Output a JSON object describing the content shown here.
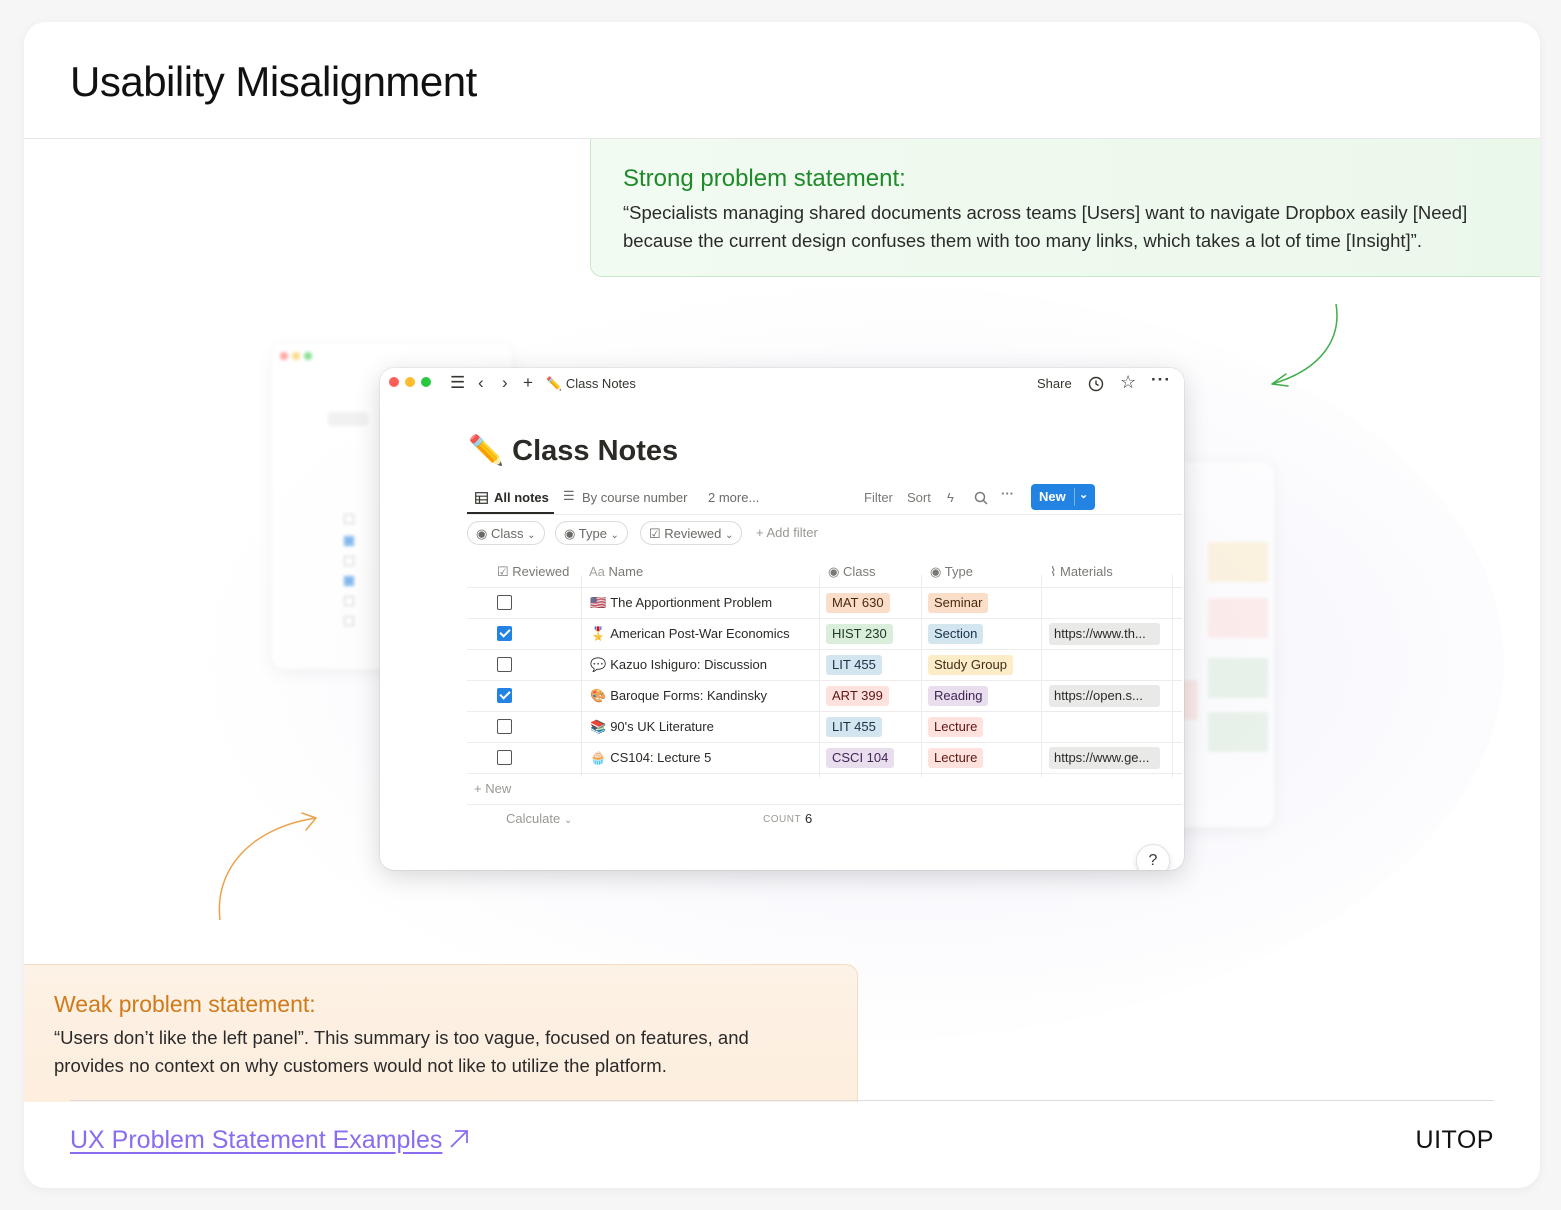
{
  "page": {
    "title": "Usability Misalignment"
  },
  "strong": {
    "heading": "Strong problem statement:",
    "text": "“Specialists managing shared documents across teams [Users] want to navigate Dropbox easily [Need] because the current design confuses them with too many links, which takes a lot of time [Insight]”.",
    "color": "#1f8a2a"
  },
  "weak": {
    "heading": "Weak problem statement:",
    "text": " “Users don’t like the left panel”. This summary is too vague, focused on features, and provides no context on why customers would not like to utilize the platform.",
    "color": "#d07a1c"
  },
  "footer": {
    "link_text": "UX Problem Statement Examples",
    "brand": "UITOP",
    "link_color": "#8a6cf0"
  },
  "app": {
    "toolbar": {
      "breadcrumb_emoji": "✏️",
      "breadcrumb": "Class Notes",
      "share": "Share"
    },
    "doc": {
      "emoji": "✏️",
      "title": "Class Notes"
    },
    "tabs": {
      "all_notes": "All notes",
      "by_course": "By course number",
      "more": "2 more..."
    },
    "tools": {
      "filter": "Filter",
      "sort": "Sort",
      "new": "New"
    },
    "filters": {
      "class": "Class",
      "type": "Type",
      "reviewed": "Reviewed",
      "add": "Add filter"
    },
    "columns": {
      "reviewed": "Reviewed",
      "name_prefix": "Aa",
      "name": "Name",
      "class": "Class",
      "type": "Type",
      "materials": "Materials"
    },
    "rows": [
      {
        "reviewed": false,
        "emoji": "🇺🇸",
        "name": "The Apportionment Problem",
        "class": "MAT 630",
        "class_bg": "#fadec9",
        "class_fg": "#49290e",
        "type": "Seminar",
        "type_bg": "#fadec9",
        "type_fg": "#49290e",
        "material": ""
      },
      {
        "reviewed": true,
        "emoji": "🎖️",
        "name": "American Post-War Economics",
        "class": "HIST 230",
        "class_bg": "#dbeddb",
        "class_fg": "#1c3829",
        "type": "Section",
        "type_bg": "#d3e5ef",
        "type_fg": "#183347",
        "material": "https://www.th..."
      },
      {
        "reviewed": false,
        "emoji": "💬",
        "name": "Kazuo Ishiguro: Discussion",
        "class": "LIT 455",
        "class_bg": "#d3e5ef",
        "class_fg": "#183347",
        "type": "Study Group",
        "type_bg": "#fdecc8",
        "type_fg": "#402c1b",
        "material": ""
      },
      {
        "reviewed": true,
        "emoji": "🎨",
        "name": "Baroque Forms: Kandinsky",
        "class": "ART 399",
        "class_bg": "#ffe2dd",
        "class_fg": "#5d1715",
        "type": "Reading",
        "type_bg": "#e8deee",
        "type_fg": "#412454",
        "material": "https://open.s..."
      },
      {
        "reviewed": false,
        "emoji": "📚",
        "name": "90's UK Literature",
        "class": "LIT 455",
        "class_bg": "#d3e5ef",
        "class_fg": "#183347",
        "type": "Lecture",
        "type_bg": "#ffe2dd",
        "type_fg": "#5d1715",
        "material": ""
      },
      {
        "reviewed": false,
        "emoji": "🧁",
        "name": "CS104: Lecture 5",
        "class": "CSCI 104",
        "class_bg": "#e8deee",
        "class_fg": "#412454",
        "type": "Lecture",
        "type_bg": "#ffe2dd",
        "type_fg": "#5d1715",
        "material": "https://www.ge..."
      }
    ],
    "footer": {
      "add_new": "New",
      "calculate": "Calculate",
      "count_label": "COUNT",
      "count": "6"
    },
    "help": "?"
  }
}
